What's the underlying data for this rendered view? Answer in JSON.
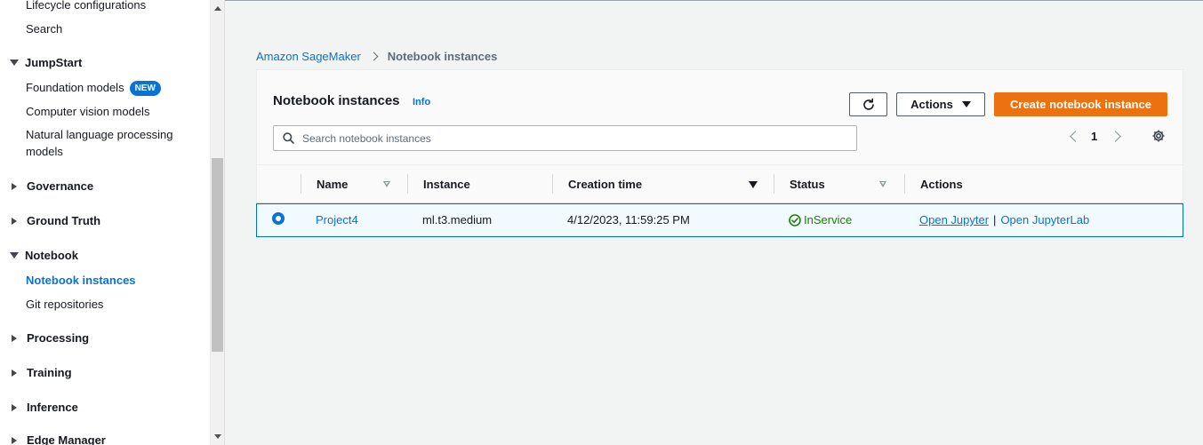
{
  "sidebar": {
    "items": [
      {
        "label": "Lifecycle configurations"
      },
      {
        "label": "Search"
      },
      {
        "label": "JumpStart"
      },
      {
        "label": "Foundation models",
        "badge": "NEW"
      },
      {
        "label": "Computer vision models"
      },
      {
        "label": "Natural language processing"
      },
      {
        "label": "models"
      },
      {
        "label": "Governance"
      },
      {
        "label": "Ground Truth"
      },
      {
        "label": "Notebook"
      },
      {
        "label": "Notebook instances"
      },
      {
        "label": "Git repositories"
      },
      {
        "label": "Processing"
      },
      {
        "label": "Training"
      },
      {
        "label": "Inference"
      },
      {
        "label": "Edge Manager"
      }
    ]
  },
  "breadcrumb": {
    "root": "Amazon SageMaker",
    "current": "Notebook instances"
  },
  "panel": {
    "title": "Notebook instances",
    "info": "Info",
    "actions_label": "Actions",
    "create_label": "Create notebook instance",
    "search_placeholder": "Search notebook instances",
    "page": "1"
  },
  "table": {
    "columns": [
      "Name",
      "Instance",
      "Creation time",
      "Status",
      "Actions"
    ],
    "rows": [
      {
        "name": "Project4",
        "instance": "ml.t3.medium",
        "creation_time": "4/12/2023, 11:59:25 PM",
        "status": "InService",
        "action_1": "Open Jupyter",
        "separator": "|",
        "action_2": "Open JupyterLab"
      }
    ]
  },
  "colors": {
    "accent": "#0972d3",
    "primary_button": "#ec7211",
    "status_ok": "#1d8102"
  }
}
